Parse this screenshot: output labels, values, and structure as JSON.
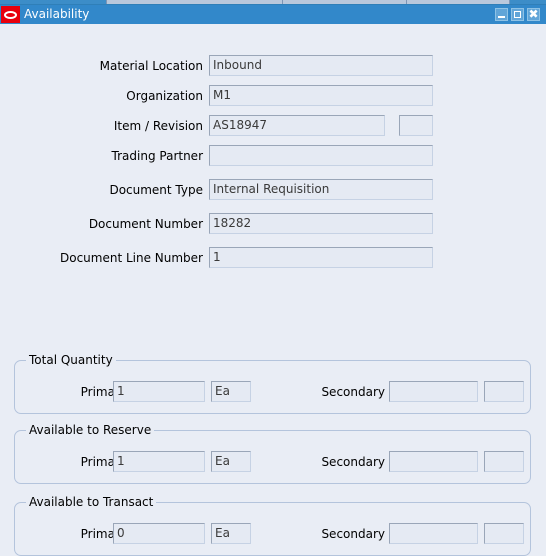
{
  "window": {
    "title": "Availability",
    "logo_icon": "oracle-logo-icon",
    "controls": [
      {
        "name": "minimize",
        "icon": "minimize-icon"
      },
      {
        "name": "restore",
        "icon": "restore-icon"
      },
      {
        "name": "close",
        "icon": "close-icon",
        "glyph": "✖"
      }
    ]
  },
  "colors": {
    "titlebar": "#3288ca",
    "canvas": "#e9edf5",
    "field_bg": "#e5eaf3",
    "field_border_dark": "#9aa6b8",
    "group_border": "#b4c4dc",
    "logo_red": "#e8000d"
  },
  "form": {
    "fields": [
      {
        "label": "Material Location",
        "value": "Inbound",
        "placeholder": ""
      },
      {
        "label": "Organization",
        "value": "M1",
        "placeholder": ""
      },
      {
        "label": "Item / Revision",
        "value": "AS18947",
        "placeholder": "",
        "revision": ""
      },
      {
        "label": "Trading Partner",
        "value": "",
        "placeholder": ""
      },
      {
        "label": "Document Type",
        "value": "Internal Requisition",
        "placeholder": ""
      },
      {
        "label": "Document Number",
        "value": "18282",
        "placeholder": ""
      },
      {
        "label": "Document Line Number",
        "value": "1",
        "placeholder": ""
      }
    ]
  },
  "groups": [
    {
      "legend": "Total Quantity",
      "primary_label": "Primary",
      "primary_value": "1",
      "primary_uom": "Ea",
      "secondary_label": "Secondary",
      "secondary_value": "",
      "secondary_uom": ""
    },
    {
      "legend": "Available to Reserve",
      "primary_label": "Primary",
      "primary_value": "1",
      "primary_uom": "Ea",
      "secondary_label": "Secondary",
      "secondary_value": "",
      "secondary_uom": ""
    },
    {
      "legend": "Available to Transact",
      "primary_label": "Primary",
      "primary_value": "0",
      "primary_uom": "Ea",
      "secondary_label": "Secondary",
      "secondary_value": "",
      "secondary_uom": ""
    }
  ]
}
